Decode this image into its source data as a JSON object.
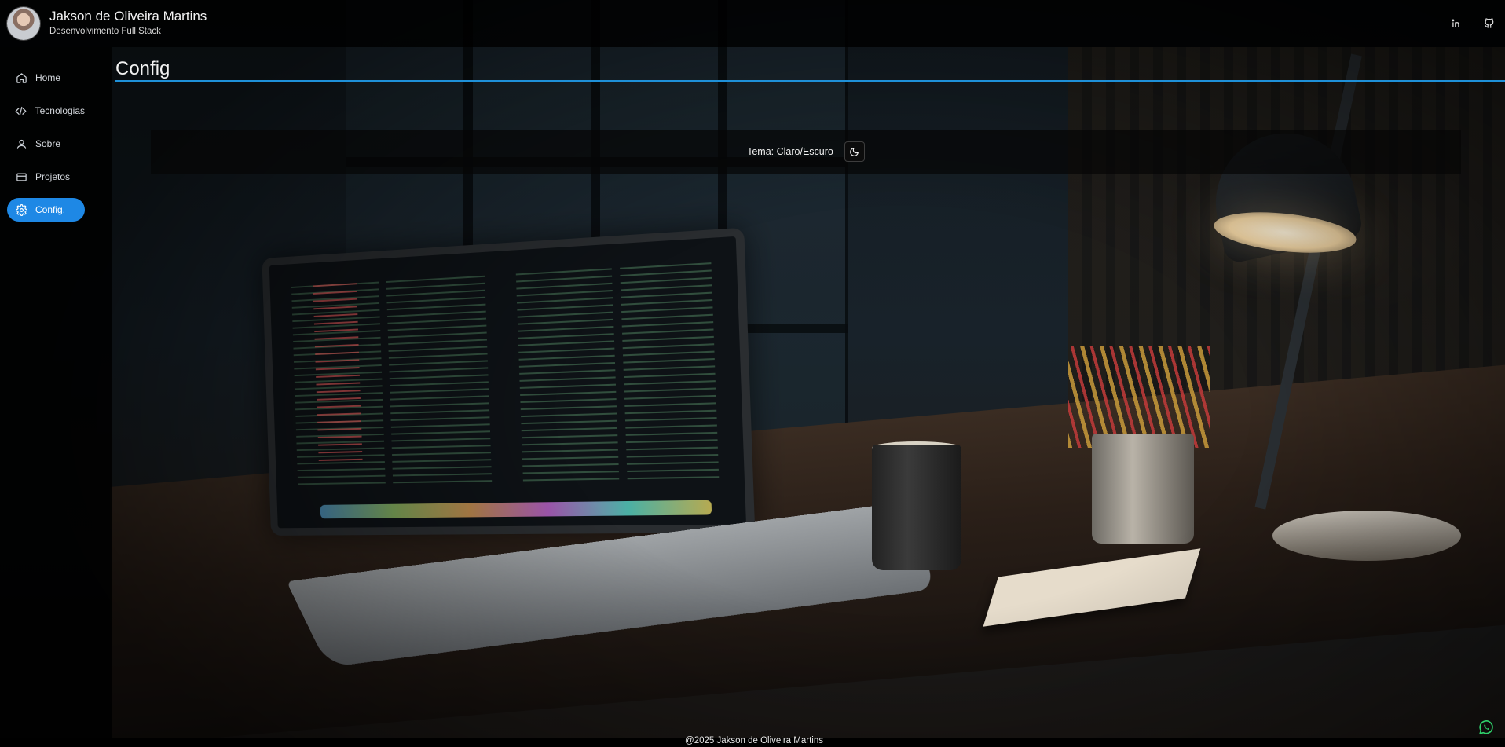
{
  "header": {
    "user_name": "Jakson de Oliveira Martins",
    "user_role": "Desenvolvimento Full Stack",
    "icons": [
      "linkedin-icon",
      "github-icon"
    ]
  },
  "sidebar": {
    "items": [
      {
        "label": "Home",
        "icon": "home-icon",
        "active": false
      },
      {
        "label": "Tecnologias",
        "icon": "code-icon",
        "active": false
      },
      {
        "label": "Sobre",
        "icon": "user-icon",
        "active": false
      },
      {
        "label": "Projetos",
        "icon": "card-icon",
        "active": false
      },
      {
        "label": "Config.",
        "icon": "gear-icon",
        "active": true
      }
    ]
  },
  "main": {
    "title": "Config",
    "theme": {
      "label": "Tema: Claro/Escuro",
      "toggle_icon": "moon-icon"
    }
  },
  "footer": {
    "text": "@2025 Jakson de Oliveira Martins"
  },
  "floating": {
    "icon": "whatsapp-icon"
  },
  "colors": {
    "accent": "#1e88e5",
    "title_rule": "#1e90d8",
    "bar_bg": "#000000"
  }
}
